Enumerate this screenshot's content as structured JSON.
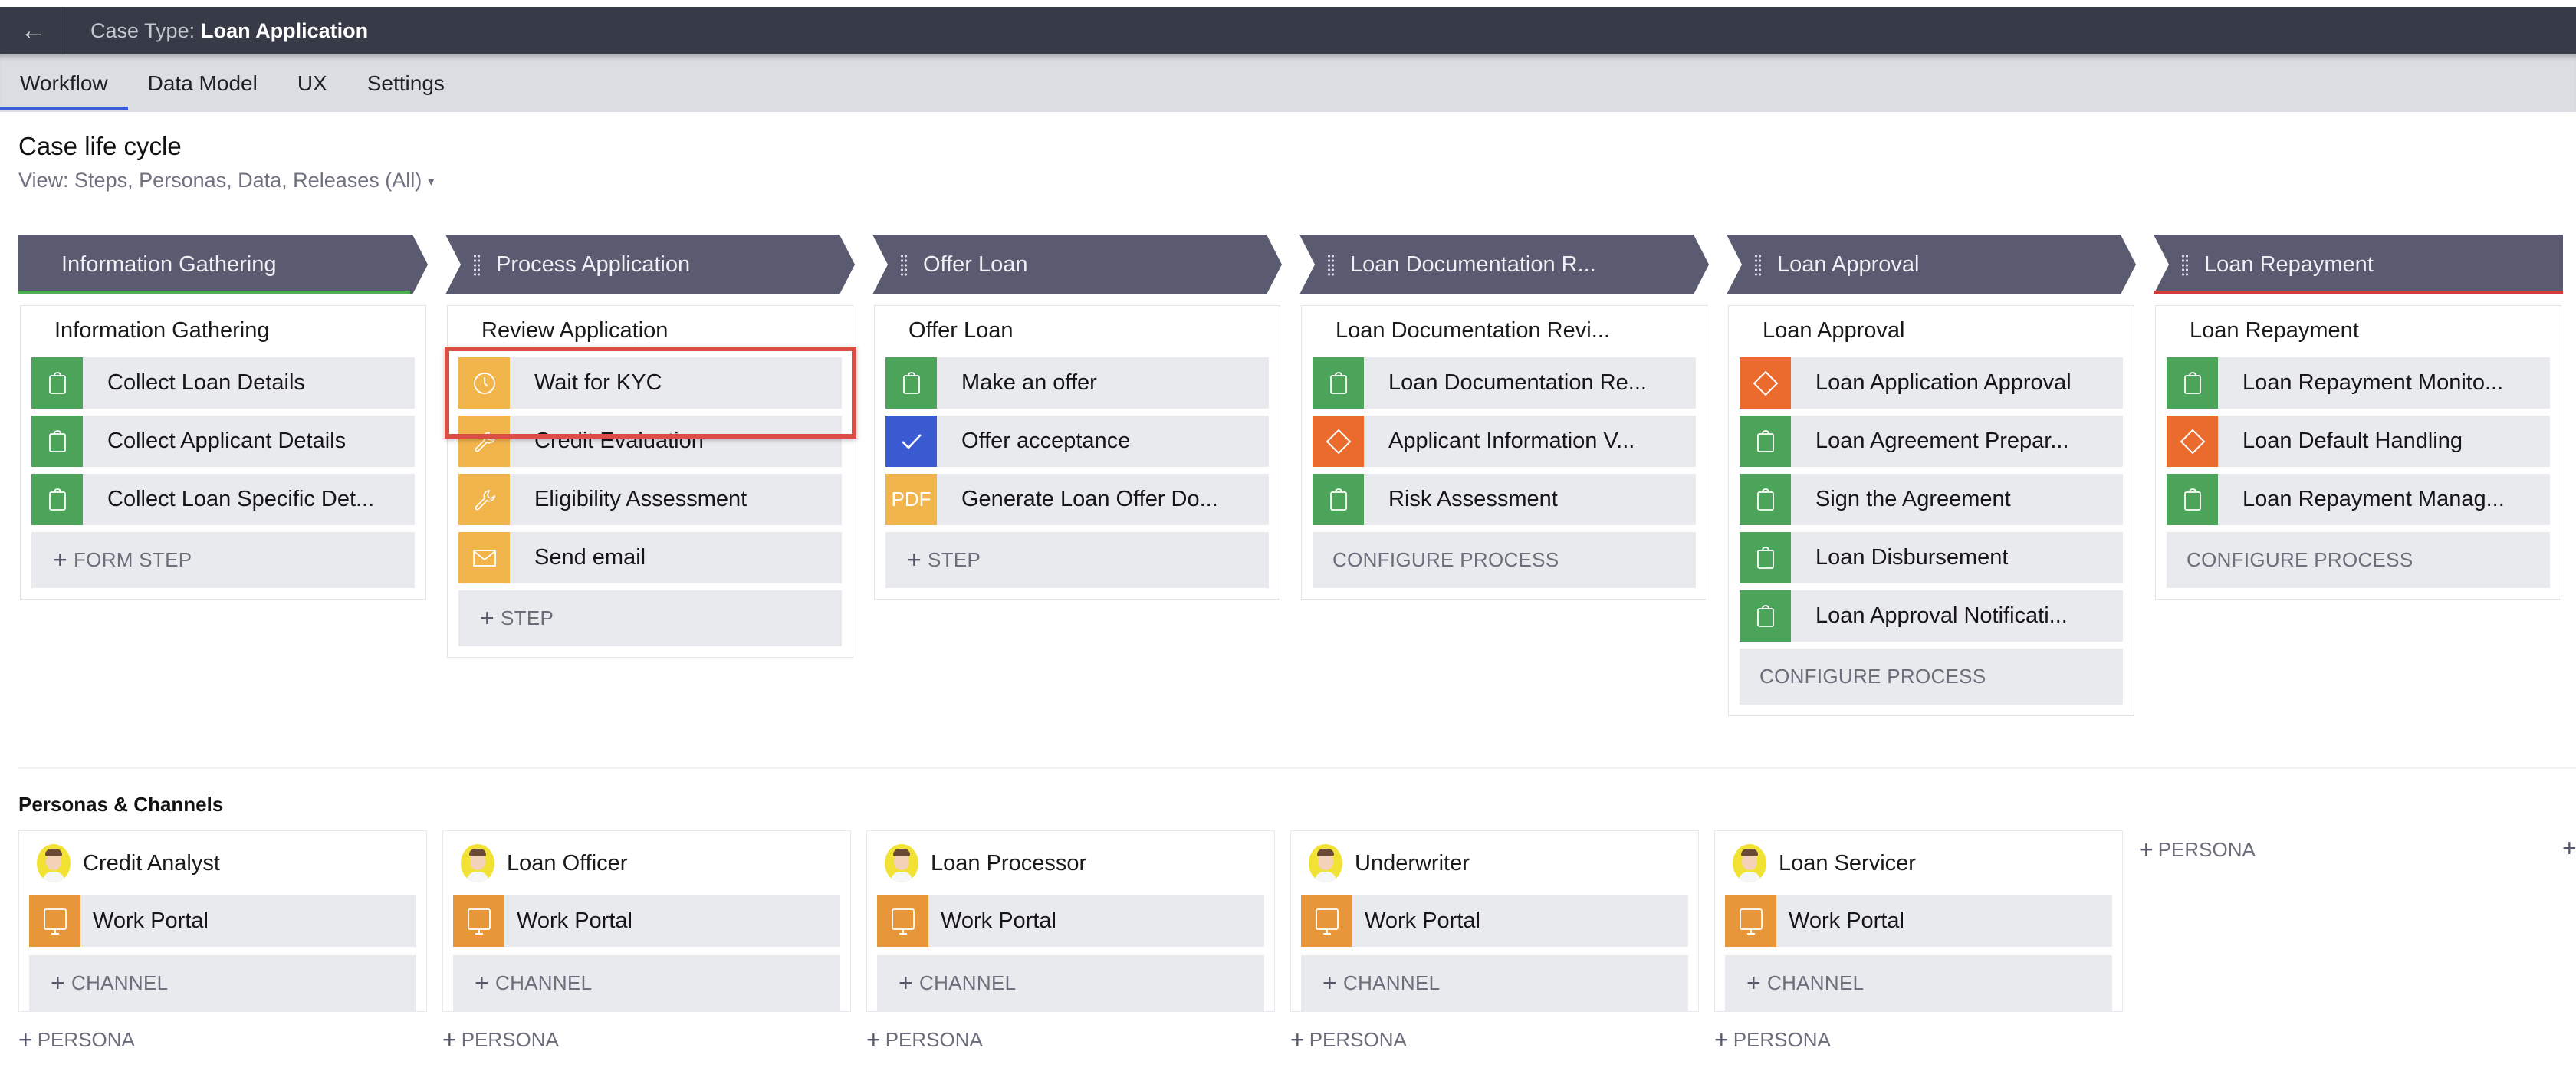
{
  "header": {
    "back_icon": "arrow-left-icon",
    "case_type_label": "Case Type:",
    "case_type_value": "Loan Application"
  },
  "tabs": [
    {
      "label": "Workflow",
      "active": true
    },
    {
      "label": "Data Model",
      "active": false
    },
    {
      "label": "UX",
      "active": false
    },
    {
      "label": "Settings",
      "active": false
    }
  ],
  "lifecycle": {
    "title": "Case life cycle",
    "view_label": "View: Steps, Personas, Data, Releases (All)",
    "caret": "▾"
  },
  "colors": {
    "stage_header": "#5a5b70",
    "form_step": "#4ba45a",
    "utility_step": "#f2b54c",
    "approval_step": "#eb6a2d",
    "check_step": "#3a5ad1",
    "channel": "#e8963a",
    "first_stage_accent": "#4caf50",
    "last_stage_accent": "#d73a3a",
    "highlight_box": "#dc4d46",
    "active_tab": "#3b5bdb"
  },
  "stages": [
    {
      "label": "Information Gathering",
      "process": "Information Gathering",
      "steps": [
        {
          "label": "Collect Loan Details",
          "type": "form",
          "icon": "clipboard-icon"
        },
        {
          "label": "Collect Applicant Details",
          "type": "form",
          "icon": "clipboard-icon"
        },
        {
          "label": "Collect Loan Specific Det...",
          "type": "form",
          "icon": "clipboard-icon"
        }
      ],
      "add_label": "FORM STEP"
    },
    {
      "label": "Process Application",
      "process": "Review Application",
      "steps": [
        {
          "label": "Wait for KYC",
          "type": "utility",
          "icon": "clock-icon",
          "highlighted": true
        },
        {
          "label": "Credit Evaluation",
          "type": "utility",
          "icon": "wrench-icon"
        },
        {
          "label": "Eligibility Assessment",
          "type": "utility",
          "icon": "wrench-icon"
        },
        {
          "label": "Send email",
          "type": "utility",
          "icon": "envelope-icon"
        }
      ],
      "add_label": "STEP"
    },
    {
      "label": "Offer Loan",
      "process": "Offer Loan",
      "steps": [
        {
          "label": "Make an offer",
          "type": "form",
          "icon": "clipboard-icon"
        },
        {
          "label": "Offer acceptance",
          "type": "check",
          "icon": "checkmark-icon"
        },
        {
          "label": "Generate Loan Offer Do...",
          "type": "utility",
          "icon": "pdf-icon",
          "icon_text": "PDF"
        }
      ],
      "add_label": "STEP"
    },
    {
      "label": "Loan Documentation R...",
      "process": "Loan Documentation Revi...",
      "steps": [
        {
          "label": "Loan Documentation Re...",
          "type": "form",
          "icon": "clipboard-icon"
        },
        {
          "label": "Applicant Information V...",
          "type": "approval",
          "icon": "diamond-icon"
        },
        {
          "label": "Risk Assessment",
          "type": "form",
          "icon": "clipboard-icon"
        }
      ],
      "configure_label": "CONFIGURE PROCESS"
    },
    {
      "label": "Loan Approval",
      "process": "Loan Approval",
      "steps": [
        {
          "label": "Loan Application Approval",
          "type": "approval",
          "icon": "diamond-icon"
        },
        {
          "label": "Loan Agreement Prepar...",
          "type": "form",
          "icon": "clipboard-icon"
        },
        {
          "label": "Sign the Agreement",
          "type": "form",
          "icon": "clipboard-icon"
        },
        {
          "label": "Loan Disbursement",
          "type": "form",
          "icon": "clipboard-icon"
        },
        {
          "label": "Loan Approval Notificati...",
          "type": "form",
          "icon": "clipboard-icon"
        }
      ],
      "configure_label": "CONFIGURE PROCESS"
    },
    {
      "label": "Loan Repayment",
      "process": "Loan Repayment",
      "steps": [
        {
          "label": "Loan Repayment Monito...",
          "type": "form",
          "icon": "clipboard-icon"
        },
        {
          "label": "Loan Default Handling",
          "type": "approval",
          "icon": "diamond-icon"
        },
        {
          "label": "Loan Repayment Manag...",
          "type": "form",
          "icon": "clipboard-icon"
        }
      ],
      "configure_label": "CONFIGURE PROCESS"
    }
  ],
  "personas_section": {
    "title": "Personas & Channels",
    "personas": [
      {
        "name": "Credit Analyst",
        "channel": "Work Portal"
      },
      {
        "name": "Loan Officer",
        "channel": "Work Portal"
      },
      {
        "name": "Loan Processor",
        "channel": "Work Portal"
      },
      {
        "name": "Underwriter",
        "channel": "Work Portal"
      },
      {
        "name": "Loan Servicer",
        "channel": "Work Portal"
      }
    ],
    "add_channel_label": "CHANNEL",
    "add_persona_label": "PERSONA",
    "plus": "+"
  }
}
